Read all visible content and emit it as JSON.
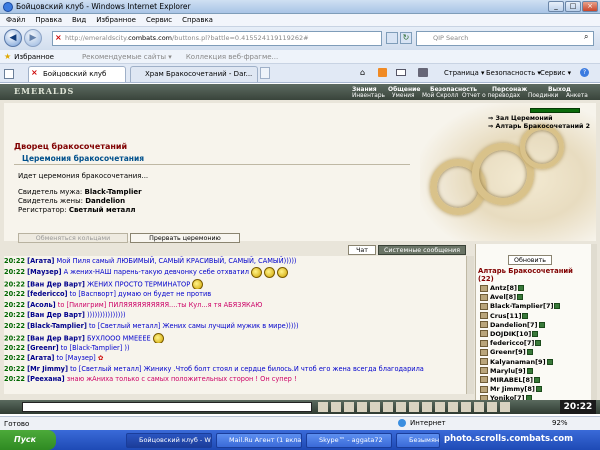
{
  "window": {
    "title": "Бойцовский клуб - Windows Internet Explorer"
  },
  "menu": [
    "Файл",
    "Правка",
    "Вид",
    "Избранное",
    "Сервис",
    "Справка"
  ],
  "address": {
    "prefix": "http://emeraldscity.",
    "domain": "combats.com",
    "suffix": "/buttons.pl?battle=0.415524119119262#"
  },
  "search": {
    "placeholder": "QIP Search"
  },
  "favbar": {
    "favorites": "Избранное",
    "item1": "Рекомендуемые сайты ▾",
    "item2": "Коллекция веб-фрагме..."
  },
  "tabs": {
    "tab1": "Бойцовский клуб",
    "tab2": "Храм Бракосочетаний - Dar..."
  },
  "toolbar": {
    "page": "Страница ▾",
    "safety": "Безопасность ▾",
    "tools": "Сервис ▾"
  },
  "game": {
    "logo": "EMERALDS",
    "nav": [
      "Знания",
      "Общение",
      "Безопасность",
      "Персонаж",
      "Выход"
    ],
    "subnav": [
      "Инвентарь",
      "Умения",
      "Мой Скролл",
      "Отчет о переводах",
      "Поединки",
      "Анкета"
    ],
    "panel_title": "Дворец бракосочетаний",
    "panel_subtitle": "Церемония бракосочетания",
    "status": "Идет церемония бракосочетания...",
    "groom_label": "Свидетель мужа:",
    "groom": "Black-Tamplier",
    "bride_label": "Свидетель жены:",
    "bride": "Dandelion",
    "registrar_label": "Регистратор:",
    "registrar": "Светлый металл",
    "btn_exchange": "Обменяться кольцами",
    "btn_stop": "Прервать церемонию",
    "links": [
      "Зал Церемоний",
      "Алтарь Бракосочетаний 2"
    ]
  },
  "chat": {
    "tab_chat": "Чат",
    "tab_system": "Системные сообщения",
    "refresh": "Обновить",
    "room_title": "Алтарь Бракосочетаний",
    "room_count": "(22)",
    "messages": [
      {
        "time": "20:22",
        "nick": "[Агата]",
        "text": " Мой Пиля самый ЛЮБИМЫЙ, САМЫЙ КРАСИВЫЙ, САМЫЙ, САМЫЙ)))))",
        "cls": "blue"
      },
      {
        "time": "20:22",
        "nick": "[Маузер]",
        "text": " А жених-НАШ парень-такую девчонку себе отхватил",
        "cls": "blue"
      },
      {
        "time": "20:22",
        "nick": "[Ван Дер Варт]",
        "text": " ЖЕНИХ ПРОСТО ТЕРМИНАТОР",
        "cls": "blue"
      },
      {
        "time": "20:22",
        "nick": "[federicco]",
        "text": " to [Васпворт] думаю он будет не против",
        "cls": "blue"
      },
      {
        "time": "20:22",
        "nick": "[Асоль]",
        "text": " to [Пилигрим] ПИЛЯЯЯЯЯЯЯЯЯЯ....ты Кул...я тя АБЯЗЯКАЮ",
        "cls": "pink"
      },
      {
        "time": "20:22",
        "nick": "[Ван Дер Варт]",
        "text": " )))))))))))))))",
        "cls": "blue"
      },
      {
        "time": "20:22",
        "nick": "[Black-Tamplier]",
        "text": " to [Светлый металл] Жених самы лучщий мужик в мире)))))",
        "cls": "blue"
      },
      {
        "time": "20:22",
        "nick": "[Ван Дер Варт]",
        "text": " БУХЛООО ММЕЕЕЕ",
        "cls": "blue"
      },
      {
        "time": "20:22",
        "nick": "[Greenr]",
        "text": " to [Black-Tamplier] ))",
        "cls": "blue"
      },
      {
        "time": "20:22",
        "nick": "[Агата]",
        "text": " to [Маузер]",
        "cls": "blue"
      },
      {
        "time": "20:22",
        "nick": "[Mr Jimmy]",
        "text": " to [Светлый металл] Жинику .Чтоб болт стоял и сердце билось.И чтоб его жена всегда благодарила",
        "cls": "blue"
      },
      {
        "time": "20:22",
        "nick": "[Реехана]",
        "text": " знаю жАниха только с самых положительных сторон ! Он супер !",
        "cls": "pink"
      }
    ],
    "users": [
      {
        "name": "Antz",
        "lvl": "[8]"
      },
      {
        "name": "Avel",
        "lvl": "[8]"
      },
      {
        "name": "Black-Tamplier",
        "lvl": "[7]"
      },
      {
        "name": "Crus",
        "lvl": "[11]"
      },
      {
        "name": "Dandelion",
        "lvl": "[7]"
      },
      {
        "name": "DOJDIK",
        "lvl": "[10]"
      },
      {
        "name": "federicco",
        "lvl": "[7]"
      },
      {
        "name": "Greenr",
        "lvl": "[9]"
      },
      {
        "name": "Kalyanaman",
        "lvl": "[9]"
      },
      {
        "name": "Marylu",
        "lvl": "[9]"
      },
      {
        "name": "MIRABEL",
        "lvl": "[8]"
      },
      {
        "name": "Mr Jimmy",
        "lvl": "[8]"
      },
      {
        "name": "Yoniko",
        "lvl": "[7]"
      }
    ],
    "clock": "20:22"
  },
  "status": {
    "ready": "Готово",
    "zone": "Интернет",
    "zoom": "92%"
  },
  "taskbar": {
    "start": "Пуск",
    "items": [
      "Бойцовский клуб - Wi...",
      "Mail.Ru Агент (1 вкла...",
      "Skype™ - aggata72",
      "Безымянн..."
    ]
  },
  "watermark": "photo.scrolls.combats.com"
}
